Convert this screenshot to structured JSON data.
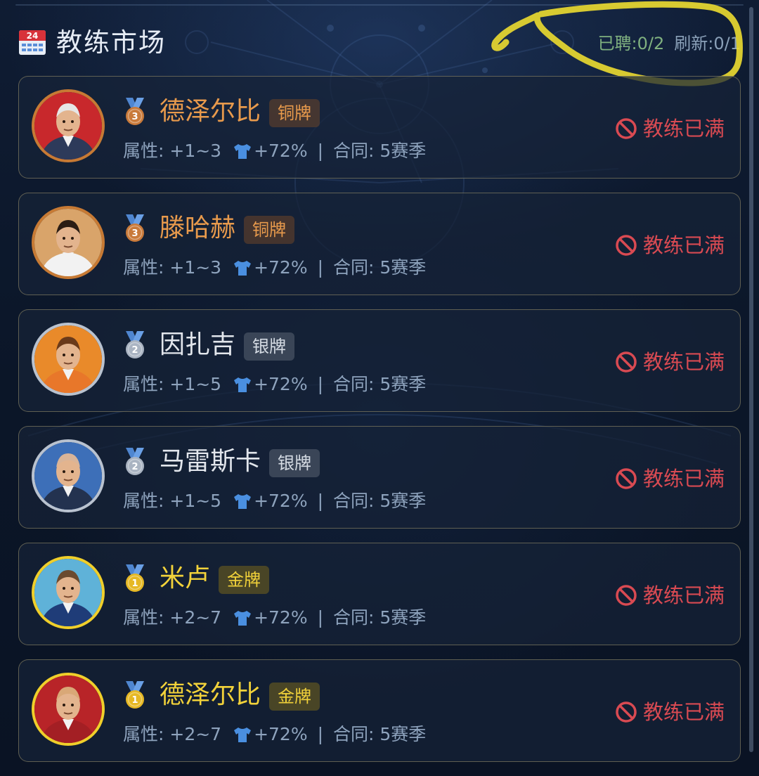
{
  "header": {
    "title": "教练市场",
    "calendar_icon_text": "24",
    "hired": "已聘:0/2",
    "refresh": "刷新:0/1"
  },
  "colors": {
    "bronze_name": "#e89a4c",
    "silver_name": "#e2e6ec",
    "gold_name": "#f2d23a",
    "full_status": "#d94a52",
    "annotation": "#f0e03a"
  },
  "coaches": [
    {
      "name": "德泽尔比",
      "tier": "铜牌",
      "medal_number": "3",
      "tier_key": "bronze",
      "attr": "属性: +1~3",
      "bonus": "+72%",
      "contract": "合同: 5赛季",
      "status": "教练已满",
      "avatar_icon": "coach-avatar-grey-hair"
    },
    {
      "name": "滕哈赫",
      "tier": "铜牌",
      "medal_number": "3",
      "tier_key": "bronze",
      "attr": "属性: +1~3",
      "bonus": "+72%",
      "contract": "合同: 5赛季",
      "status": "教练已满",
      "avatar_icon": "coach-avatar-beard"
    },
    {
      "name": "因扎吉",
      "tier": "银牌",
      "medal_number": "2",
      "tier_key": "silver",
      "attr": "属性: +1~5",
      "bonus": "+72%",
      "contract": "合同: 5赛季",
      "status": "教练已满",
      "avatar_icon": "coach-avatar-cap"
    },
    {
      "name": "马雷斯卡",
      "tier": "银牌",
      "medal_number": "2",
      "tier_key": "silver",
      "attr": "属性: +1~5",
      "bonus": "+72%",
      "contract": "合同: 5赛季",
      "status": "教练已满",
      "avatar_icon": "coach-avatar-bald-suit"
    },
    {
      "name": "米卢",
      "tier": "金牌",
      "medal_number": "1",
      "tier_key": "gold",
      "attr": "属性: +2~7",
      "bonus": "+72%",
      "contract": "合同: 5赛季",
      "status": "教练已满",
      "avatar_icon": "coach-avatar-brown-hair"
    },
    {
      "name": "德泽尔比",
      "tier": "金牌",
      "medal_number": "1",
      "tier_key": "gold",
      "attr": "属性: +2~7",
      "bonus": "+72%",
      "contract": "合同: 5赛季",
      "status": "教练已满",
      "avatar_icon": "coach-avatar-red-jacket"
    }
  ]
}
